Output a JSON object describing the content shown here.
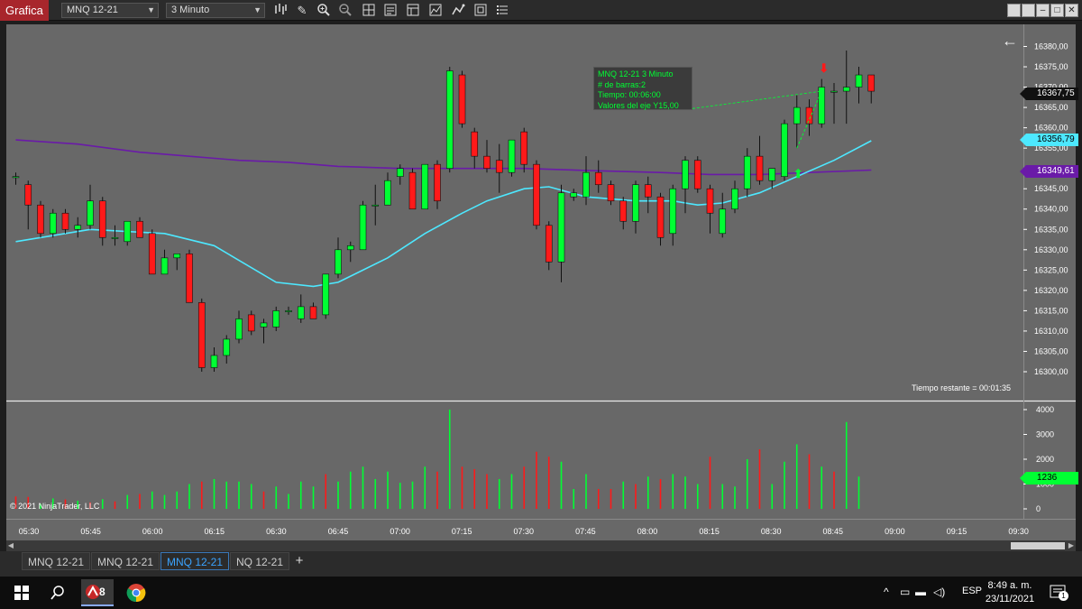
{
  "app_tab": "Grafica",
  "toolbar": {
    "instrument": "MNQ 12-21",
    "interval": "3 Minuto"
  },
  "info_box": {
    "line1": "MNQ 12-21 3 Minuto",
    "line2": "# de barras:2",
    "line3": "Tiempo:    00:06:00",
    "line4": "Valores del eje Y15,00"
  },
  "remaining": "Tiempo restante = 00:01:35",
  "copyright": "© 2021 NinjaTrader, LLC",
  "badges": {
    "last_price": "16367,75",
    "cyan_ma": "16356,79",
    "purple_ma": "16349,61",
    "volume": "1236"
  },
  "colors": {
    "up": "#00ff33",
    "down": "#ff1a1a",
    "cyan_ma": "#4de8ff",
    "purple_ma": "#6a1aa8",
    "background": "#686868",
    "app_tab": "#a8262c",
    "active_tab": "#3aa3ff"
  },
  "tabs": [
    "MNQ 12-21",
    "MNQ 12-21",
    "MNQ 12-21",
    "NQ 12-21"
  ],
  "active_tab_index": 2,
  "taskbar": {
    "lang": "ESP",
    "time": "8:49 a. m.",
    "date": "23/11/2021",
    "app_badge": "8",
    "notif_count": "1"
  },
  "chart_data": {
    "type": "candlestick",
    "instrument": "MNQ 12-21",
    "interval": "3 Minuto",
    "price_axis": {
      "ticks": [
        "16300,00",
        "16305,00",
        "16310,00",
        "16315,00",
        "16320,00",
        "16325,00",
        "16330,00",
        "16335,00",
        "16340,00",
        "16345,00",
        "16350,00",
        "16355,00",
        "16360,00",
        "16365,00",
        "16370,00",
        "16375,00",
        "16380,00"
      ],
      "ylim": [
        16298,
        16381
      ]
    },
    "volume_axis": {
      "ticks": [
        "0",
        "1000",
        "2000",
        "3000",
        "4000"
      ],
      "ylim": [
        0,
        4000
      ]
    },
    "time_axis": [
      "05:30",
      "05:45",
      "06:00",
      "06:15",
      "06:30",
      "06:45",
      "07:00",
      "07:15",
      "07:30",
      "07:45",
      "08:00",
      "08:15",
      "08:30",
      "08:45",
      "09:00",
      "09:15",
      "09:30"
    ],
    "candles": [
      [
        16348,
        16349,
        16346,
        16348
      ],
      [
        16346,
        16347,
        16335,
        16341
      ],
      [
        16341,
        16342,
        16333,
        16334
      ],
      [
        16334,
        16340,
        16333,
        16339
      ],
      [
        16339,
        16340,
        16334,
        16335
      ],
      [
        16335,
        16338,
        16333,
        16336
      ],
      [
        16336,
        16346,
        16335,
        16342
      ],
      [
        16342,
        16343,
        16331,
        16333
      ],
      [
        16333,
        16336,
        16331,
        16333
      ],
      [
        16332,
        16337,
        16331,
        16337
      ],
      [
        16337,
        16338,
        16333,
        16333
      ],
      [
        16334,
        16335,
        16324,
        16324
      ],
      [
        16324,
        16330,
        16324,
        16328
      ],
      [
        16328,
        16329,
        16325,
        16329
      ],
      [
        16329,
        16330,
        16317,
        16317
      ],
      [
        16317,
        16318,
        16300,
        16301
      ],
      [
        16301,
        16306,
        16300,
        16304
      ],
      [
        16304,
        16309,
        16302,
        16308
      ],
      [
        16308,
        16315,
        16307,
        16313
      ],
      [
        16314,
        16315,
        16309,
        16310
      ],
      [
        16311,
        16313,
        16307,
        16312
      ],
      [
        16311,
        16316,
        16310,
        16315
      ],
      [
        16315,
        16316,
        16314,
        16315
      ],
      [
        16313,
        16319,
        16312,
        16316
      ],
      [
        16316,
        16317,
        16313,
        16313
      ],
      [
        16314,
        16324,
        16313,
        16324
      ],
      [
        16324,
        16333,
        16323,
        16330
      ],
      [
        16330,
        16332,
        16327,
        16331
      ],
      [
        16330,
        16342,
        16330,
        16341
      ],
      [
        16341,
        16346,
        16336,
        16341
      ],
      [
        16341,
        16349,
        16341,
        16347
      ],
      [
        16348,
        16351,
        16346,
        16350
      ],
      [
        16349,
        16350,
        16340,
        16340
      ],
      [
        16340,
        16351,
        16340,
        16351
      ],
      [
        16351,
        16352,
        16340,
        16342
      ],
      [
        16350,
        16375,
        16349,
        16374
      ],
      [
        16373,
        16374,
        16360,
        16361
      ],
      [
        16359,
        16360,
        16350,
        16353
      ],
      [
        16353,
        16357,
        16349,
        16350
      ],
      [
        16352,
        16356,
        16344,
        16349
      ],
      [
        16349,
        16356,
        16348,
        16357
      ],
      [
        16359,
        16360,
        16349,
        16351
      ],
      [
        16351,
        16352,
        16335,
        16336
      ],
      [
        16336,
        16337,
        16325,
        16327
      ],
      [
        16327,
        16346,
        16322,
        16344
      ],
      [
        16343,
        16345,
        16342,
        16344
      ],
      [
        16343,
        16353,
        16341,
        16349
      ],
      [
        16349,
        16352,
        16344,
        16346
      ],
      [
        16346,
        16347,
        16341,
        16342
      ],
      [
        16342,
        16343,
        16335,
        16337
      ],
      [
        16337,
        16347,
        16334,
        16346
      ],
      [
        16346,
        16348,
        16339,
        16343
      ],
      [
        16343,
        16344,
        16331,
        16333
      ],
      [
        16334,
        16346,
        16331,
        16345
      ],
      [
        16345,
        16353,
        16339,
        16352
      ],
      [
        16352,
        16353,
        16344,
        16345
      ],
      [
        16345,
        16346,
        16334,
        16339
      ],
      [
        16334,
        16344,
        16333,
        16340
      ],
      [
        16340,
        16347,
        16339,
        16345
      ],
      [
        16345,
        16355,
        16343,
        16353
      ],
      [
        16353,
        16358,
        16346,
        16347
      ],
      [
        16347,
        16350,
        16345,
        16350
      ],
      [
        16348,
        16362,
        16347,
        16361
      ],
      [
        16361,
        16368,
        16355,
        16365
      ],
      [
        16365,
        16367,
        16358,
        16361
      ],
      [
        16361,
        16372,
        16360,
        16370
      ],
      [
        16369,
        16371,
        16361,
        16369
      ],
      [
        16369,
        16379,
        16361,
        16370
      ],
      [
        16370,
        16375,
        16366,
        16373
      ],
      [
        16373,
        16373,
        16366,
        16369
      ]
    ],
    "volume": [
      [
        0,
        500
      ],
      [
        0,
        480
      ],
      [
        1,
        200
      ],
      [
        1,
        420
      ],
      [
        0,
        380
      ],
      [
        1,
        330
      ],
      [
        0,
        260
      ],
      [
        1,
        390
      ],
      [
        0,
        300
      ],
      [
        1,
        560
      ],
      [
        0,
        600
      ],
      [
        1,
        700
      ],
      [
        1,
        560
      ],
      [
        1,
        700
      ],
      [
        1,
        1000
      ],
      [
        0,
        1100
      ],
      [
        1,
        1200
      ],
      [
        1,
        1100
      ],
      [
        1,
        1100
      ],
      [
        1,
        1000
      ],
      [
        0,
        700
      ],
      [
        1,
        900
      ],
      [
        1,
        600
      ],
      [
        1,
        1100
      ],
      [
        1,
        900
      ],
      [
        0,
        1400
      ],
      [
        1,
        1100
      ],
      [
        1,
        1500
      ],
      [
        1,
        1700
      ],
      [
        1,
        1200
      ],
      [
        1,
        1500
      ],
      [
        1,
        1050
      ],
      [
        1,
        1100
      ],
      [
        1,
        1700
      ],
      [
        0,
        1500
      ],
      [
        1,
        4000
      ],
      [
        0,
        1700
      ],
      [
        0,
        1600
      ],
      [
        0,
        1400
      ],
      [
        1,
        1200
      ],
      [
        1,
        1400
      ],
      [
        0,
        1700
      ],
      [
        0,
        2300
      ],
      [
        0,
        2100
      ],
      [
        1,
        1900
      ],
      [
        1,
        800
      ],
      [
        1,
        1400
      ],
      [
        0,
        800
      ],
      [
        0,
        800
      ],
      [
        1,
        1100
      ],
      [
        0,
        1000
      ],
      [
        1,
        1300
      ],
      [
        0,
        1200
      ],
      [
        1,
        1400
      ],
      [
        1,
        1300
      ],
      [
        1,
        1000
      ],
      [
        0,
        2100
      ],
      [
        1,
        1000
      ],
      [
        1,
        900
      ],
      [
        1,
        2000
      ],
      [
        0,
        2400
      ],
      [
        1,
        1000
      ],
      [
        1,
        1900
      ],
      [
        1,
        2600
      ],
      [
        0,
        2200
      ],
      [
        1,
        1700
      ],
      [
        0,
        1500
      ],
      [
        1,
        3500
      ],
      [
        1,
        1300
      ]
    ],
    "cyan_ma": [
      [
        0,
        16332
      ],
      [
        6,
        16335
      ],
      [
        12,
        16334
      ],
      [
        16,
        16331
      ],
      [
        21,
        16322
      ],
      [
        24,
        16321
      ],
      [
        26,
        16322
      ],
      [
        30,
        16328
      ],
      [
        33,
        16334
      ],
      [
        36,
        16339
      ],
      [
        38,
        16342
      ],
      [
        41,
        16345
      ],
      [
        43,
        16345.5
      ],
      [
        46,
        16343
      ],
      [
        50,
        16342
      ],
      [
        53,
        16342
      ],
      [
        55,
        16341
      ],
      [
        57,
        16341.5
      ],
      [
        60,
        16344
      ],
      [
        63,
        16348
      ],
      [
        66,
        16352
      ],
      [
        69,
        16356.8
      ]
    ],
    "purple_ma": [
      [
        0,
        16357
      ],
      [
        5,
        16356
      ],
      [
        10,
        16354
      ],
      [
        14,
        16353
      ],
      [
        18,
        16352
      ],
      [
        22,
        16351.5
      ],
      [
        26,
        16350.5
      ],
      [
        31,
        16350
      ],
      [
        36,
        16350
      ],
      [
        41,
        16350
      ],
      [
        46,
        16349.5
      ],
      [
        52,
        16349
      ],
      [
        56,
        16348.5
      ],
      [
        60,
        16348.5
      ],
      [
        64,
        16349
      ],
      [
        69,
        16349.6
      ]
    ]
  }
}
